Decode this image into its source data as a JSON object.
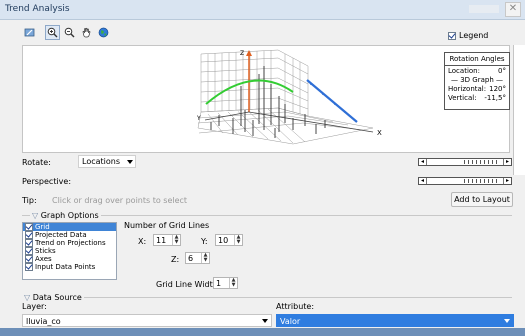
{
  "window": {
    "title": "Trend Analysis"
  },
  "toolbar": {
    "tools": [
      {
        "icon": "pin-icon"
      },
      {
        "icon": "zoom-in-icon",
        "active": true
      },
      {
        "icon": "zoom-out-icon"
      },
      {
        "icon": "hand-pan-icon"
      },
      {
        "icon": "globe-full-extent-icon"
      }
    ]
  },
  "legend": {
    "label": "Legend",
    "checked": true
  },
  "rotation_box": {
    "title": "Rotation Angles",
    "location_label": "Location:",
    "location_value": "0°",
    "graph_label": "— 3D Graph —",
    "horizontal_label": "Horizontal:",
    "horizontal_value": "120°",
    "vertical_label": "Vertical:",
    "vertical_value": "-11,5°"
  },
  "graph": {
    "axis_x": "X",
    "axis_y": "Y",
    "axis_z": "Z",
    "colors": {
      "projection_a": "#33cc33",
      "projection_b": "#2f6fd6",
      "z_axis": "#e06020",
      "sticks": "#333333"
    }
  },
  "controls": {
    "rotate_label": "Rotate:",
    "rotate_value": "Locations",
    "perspective_label": "Perspective:",
    "tip_label": "Tip:",
    "tip_text": "Click or drag over points to select",
    "add_to_layout": "Add to Layout"
  },
  "graph_options": {
    "header": "Graph Options",
    "items": [
      {
        "label": "Grid",
        "checked": true,
        "selected": true
      },
      {
        "label": "Projected Data",
        "checked": true
      },
      {
        "label": "Trend on Projections",
        "checked": true
      },
      {
        "label": "Sticks",
        "checked": true
      },
      {
        "label": "Axes",
        "checked": true
      },
      {
        "label": "Input Data Points",
        "checked": true
      }
    ],
    "grid_lines_label": "Number of Grid Lines",
    "x_label": "X:",
    "x_value": "11",
    "y_label": "Y:",
    "y_value": "10",
    "z_label": "Z:",
    "z_value": "6",
    "width_label": "Grid Line Width:",
    "width_value": "1"
  },
  "data_source": {
    "header": "Data Source",
    "layer_label": "Layer:",
    "layer_value": "lluvia_co",
    "attribute_label": "Attribute:",
    "attribute_value": "Valor"
  }
}
